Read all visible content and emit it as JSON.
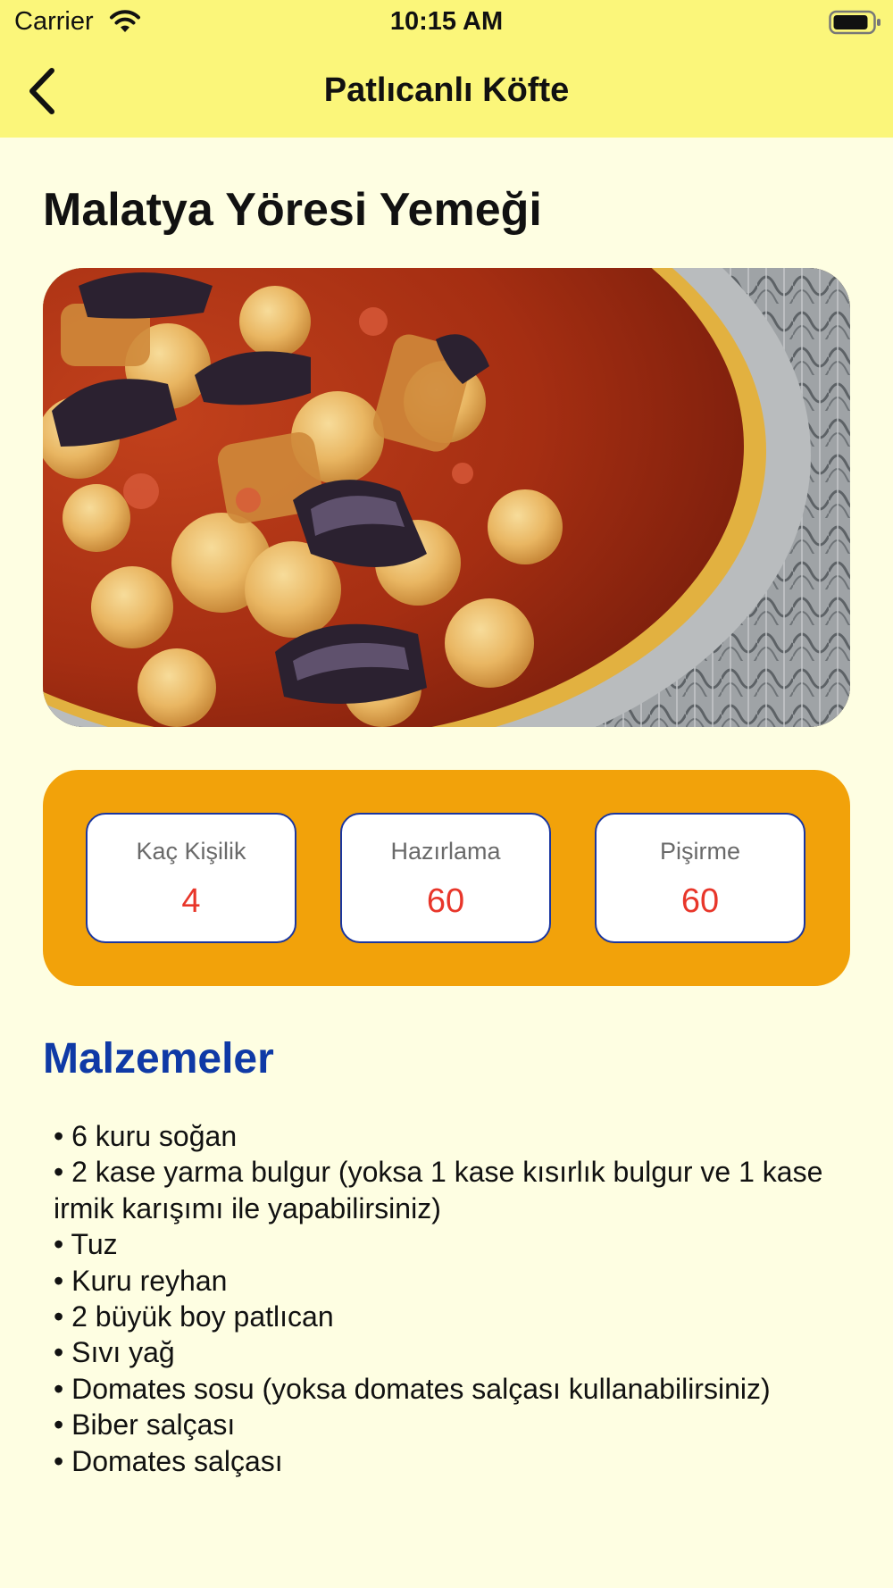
{
  "status_bar": {
    "carrier": "Carrier",
    "time": "10:15 AM"
  },
  "nav": {
    "title": "Patlıcanlı Köfte",
    "back_icon": "chevron-left-icon"
  },
  "recipe": {
    "region_title": "Malatya Yöresi Yemeği",
    "image_description_icon": "dish-photo"
  },
  "info": {
    "servings_label": "Kaç Kişilik",
    "servings_value": "4",
    "prep_label": "Hazırlama",
    "prep_value": "60",
    "cook_label": "Pişirme",
    "cook_value": "60"
  },
  "ingredients": {
    "title": "Malzemeler",
    "items": [
      "6 kuru soğan",
      "2 kase yarma bulgur (yoksa 1 kase kısırlık bulgur ve 1 kase irmik karışımı ile yapabilirsiniz)",
      "Tuz",
      "Kuru reyhan",
      "2 büyük boy patlıcan",
      "Sıvı yağ",
      "Domates sosu (yoksa domates salçası kullanabilirsiniz)",
      "Biber salçası",
      "Domates salçası"
    ]
  },
  "colors": {
    "header_bg": "#fbf67a",
    "page_bg": "#fefee2",
    "panel_bg": "#f2a20a",
    "card_border": "#1a36a0",
    "value_red": "#e8362a",
    "section_blue": "#0f3aa6"
  }
}
